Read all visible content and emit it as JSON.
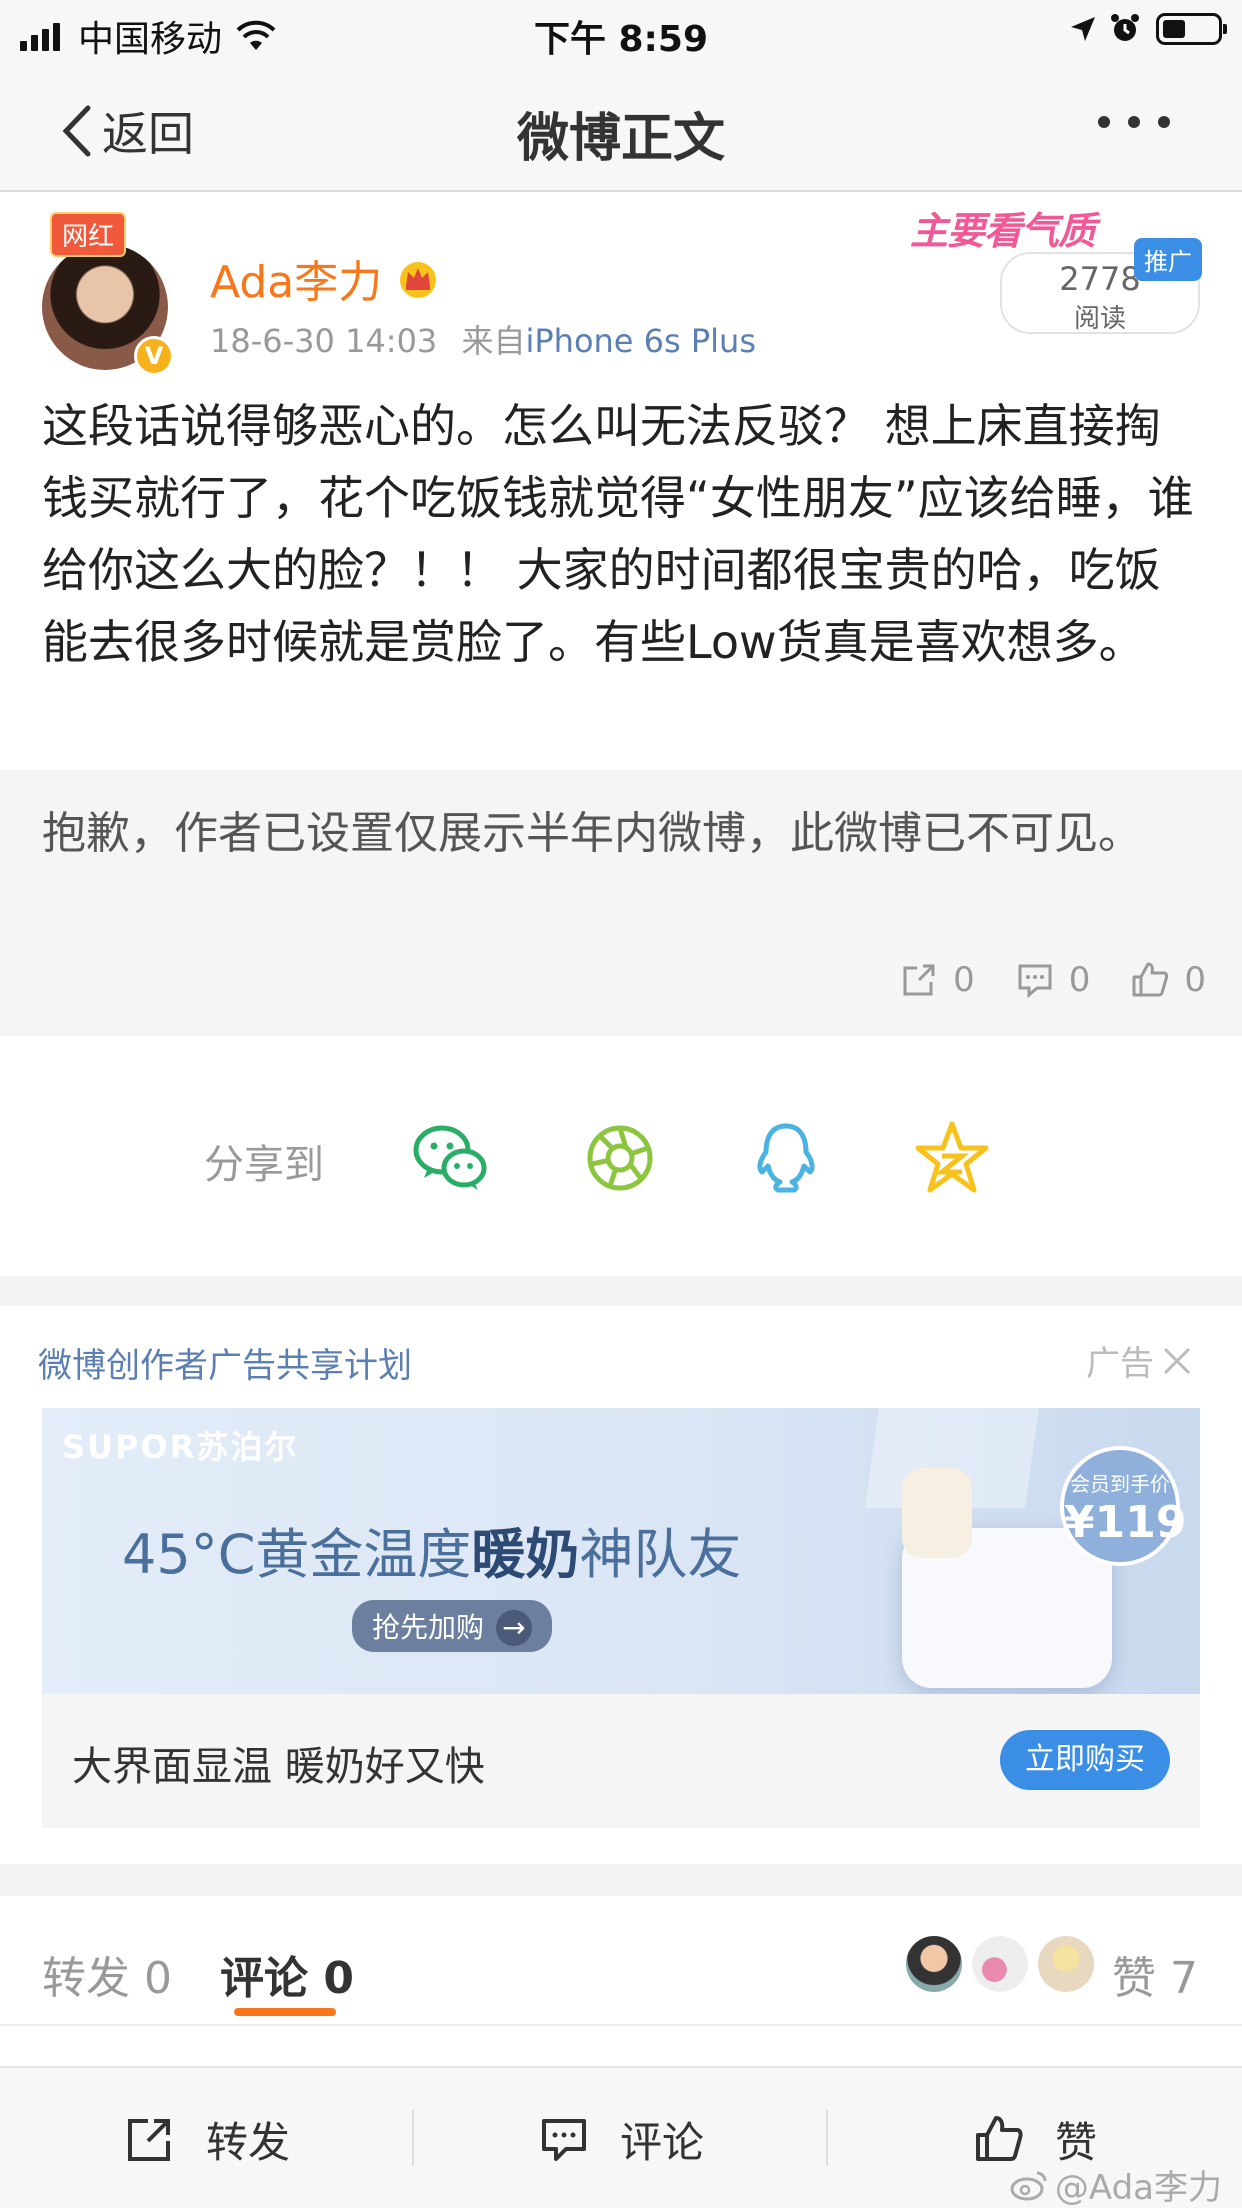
{
  "status_bar": {
    "carrier": "中国移动",
    "time": "下午 8:59",
    "icons": [
      "signal-icon",
      "wifi-icon",
      "location-icon",
      "alarm-icon",
      "battery-icon"
    ]
  },
  "nav": {
    "back_label": "返回",
    "title": "微博正文",
    "more_icon": "more-dots-icon"
  },
  "post": {
    "badge": "网红",
    "author": "Ada李力",
    "verified": "V",
    "date": "18-6-30 14:03",
    "source_prefix": "来自",
    "source": "iPhone 6s Plus",
    "promo_tag": "主要看气质",
    "read_count": "2778",
    "read_label": "阅读",
    "promoted_label": "推广",
    "text": "这段话说得够恶心的。怎么叫无法反驳？  想上床直接掏钱买就行了，花个吃饭钱就觉得“女性朋友”应该给睡，谁给你这么大的脸？！！  大家的时间都很宝贵的哈，吃饭能去很多时候就是赏脸了。有些Low货真是喜欢想多。"
  },
  "retweet": {
    "text": "抱歉，作者已设置仅展示半年内微博，此微博已不可见。",
    "repost_count": "0",
    "comment_count": "0",
    "like_count": "0"
  },
  "share": {
    "label": "分享到",
    "targets": [
      "wechat-icon",
      "moments-icon",
      "qq-icon",
      "qzone-icon"
    ]
  },
  "ad": {
    "header": "微博创作者广告共享计划",
    "tag": "广告",
    "brand": "SUPOR苏泊尔",
    "slogan_a": "45°C黄金温度",
    "slogan_b": "暖奶",
    "slogan_c": "神队友",
    "buy_label": "抢先加购",
    "price_label": "会员到手价",
    "price": "¥119",
    "description": "大界面显温 暖奶好又快",
    "cta": "立即购买"
  },
  "tabs": {
    "repost": "转发 0",
    "comment": "评论 0",
    "likes": "赞 7"
  },
  "toolbar": {
    "repost": "转发",
    "comment": "评论",
    "like": "赞",
    "watermark": "@Ada李力"
  },
  "colors": {
    "accent_orange": "#f7771a",
    "link_blue": "#5b7fb3",
    "cta_blue": "#3a8ee6",
    "wechat_green": "#2aae67",
    "moments_green": "#8cc63f",
    "qq_blue": "#4ab3e2",
    "qzone_yellow": "#f7c21b"
  }
}
